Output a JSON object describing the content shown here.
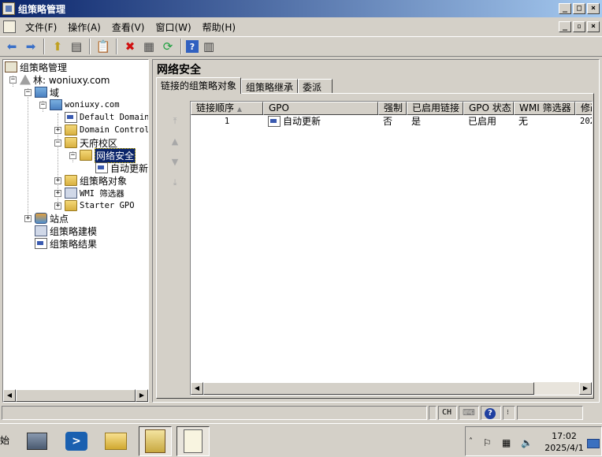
{
  "window": {
    "title": "组策略管理"
  },
  "menu": {
    "items": [
      "文件(F)",
      "操作(A)",
      "查看(V)",
      "窗口(W)",
      "帮助(H)"
    ]
  },
  "tree": {
    "root": "组策略管理",
    "forest": "林: woniuxy.com",
    "domains": "域",
    "domain": "woniuxy.com",
    "default_policy": "Default Domain",
    "dc_ou": "Domain Control",
    "ou": "天府校区",
    "selected_ou": "网络安全",
    "gpo_link": "自动更新",
    "gpo_objects": "组策略对象",
    "wmi_filters": "WMI 筛选器",
    "starter_gpo": "Starter GPO",
    "sites": "站点",
    "modeling": "组策略建模",
    "results": "组策略结果"
  },
  "details": {
    "title": "网络安全",
    "tabs": [
      "链接的组策略对象",
      "组策略继承",
      "委派"
    ],
    "columns": [
      "链接顺序",
      "GPO",
      "强制",
      "已启用链接",
      "GPO 状态",
      "WMI 筛选器",
      "修改"
    ],
    "rows": [
      {
        "order": "1",
        "gpo": "自动更新",
        "enforced": "否",
        "link_enabled": "是",
        "status": "已启用",
        "wmi": "无",
        "modified": "202"
      }
    ]
  },
  "statusbar": {
    "ime": "CH"
  },
  "taskbar": {
    "start": "始",
    "time": "17:02",
    "date": "2025/4/1"
  }
}
